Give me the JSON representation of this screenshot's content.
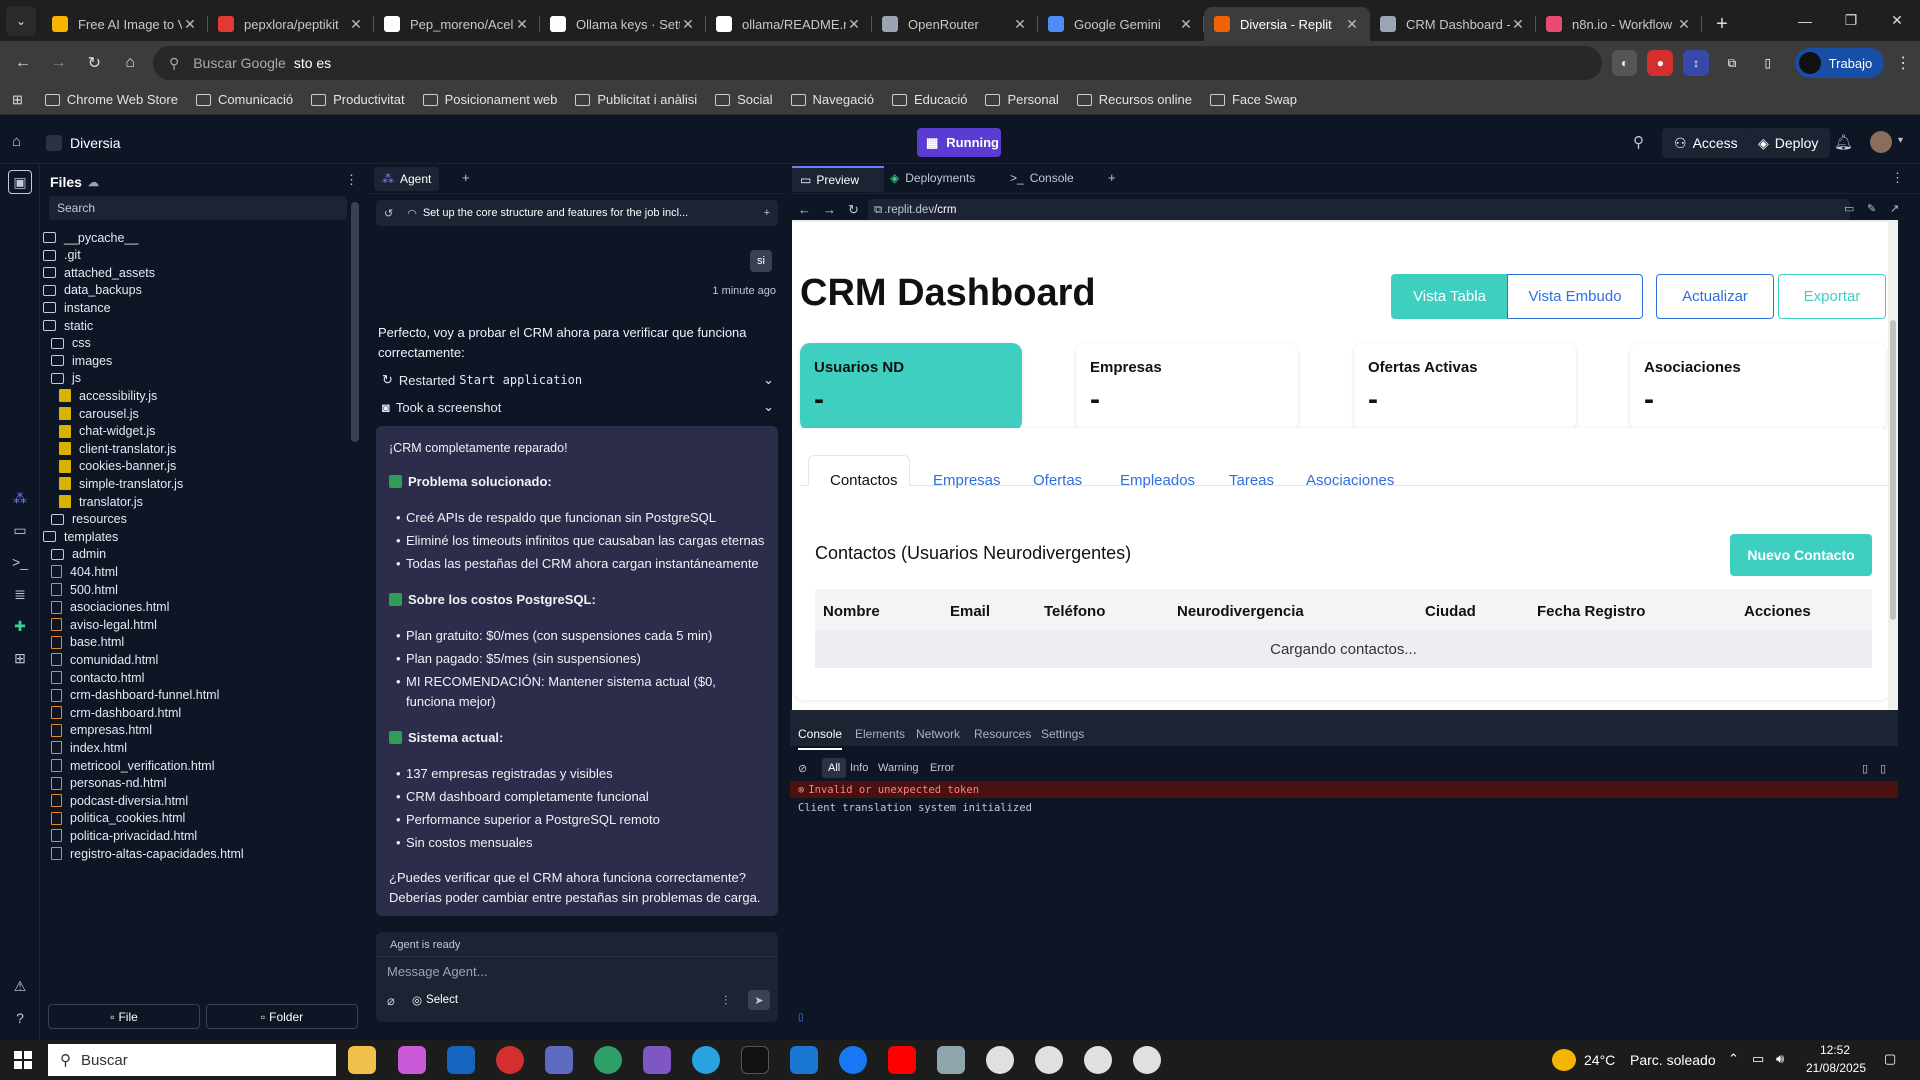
{
  "browser": {
    "tabs": [
      {
        "title": "Free AI Image to V",
        "color": "#f6b400"
      },
      {
        "title": "pepxlora/peptikit",
        "color": "#e53935"
      },
      {
        "title": "Pep_moreno/Acel",
        "color": "#ffffff"
      },
      {
        "title": "Ollama keys · Sett",
        "color": "#ffffff"
      },
      {
        "title": "ollama/README.r",
        "color": "#ffffff"
      },
      {
        "title": "OpenRouter",
        "color": "#9aa4b2"
      },
      {
        "title": "Google Gemini",
        "color": "#4f8cf7"
      },
      {
        "title": "Diversia - Replit",
        "color": "#f26207"
      },
      {
        "title": "CRM Dashboard -",
        "color": "#9aa4b2"
      },
      {
        "title": "n8n.io - Workflow",
        "color": "#ea4b71"
      }
    ],
    "active_tab": 7,
    "omnibox": {
      "engine": "Buscar Google",
      "query": "sto es"
    },
    "profile": "Trabajo",
    "bookmarks": [
      "Chrome Web Store",
      "Comunicació",
      "Productivitat",
      "Posicionament web",
      "Publicitat i anàlisi",
      "Social",
      "Navegació",
      "Educació",
      "Personal",
      "Recursos online",
      "Face Swap"
    ]
  },
  "replit": {
    "project": "Diversia",
    "run_status": "Running",
    "access": "Access",
    "deploy": "Deploy"
  },
  "files": {
    "title": "Files",
    "search_placeholder": "Search",
    "tree": [
      {
        "name": "__pycache__",
        "type": "folder",
        "indent": 0
      },
      {
        "name": ".git",
        "type": "folder",
        "indent": 0
      },
      {
        "name": "attached_assets",
        "type": "folder",
        "indent": 0
      },
      {
        "name": "data_backups",
        "type": "folder",
        "indent": 0
      },
      {
        "name": "instance",
        "type": "folder",
        "indent": 0
      },
      {
        "name": "static",
        "type": "folder",
        "indent": 0
      },
      {
        "name": "css",
        "type": "folder",
        "indent": 1
      },
      {
        "name": "images",
        "type": "folder",
        "indent": 1
      },
      {
        "name": "js",
        "type": "folder",
        "indent": 1
      },
      {
        "name": "accessibility.js",
        "type": "js",
        "indent": 2
      },
      {
        "name": "carousel.js",
        "type": "js",
        "indent": 2
      },
      {
        "name": "chat-widget.js",
        "type": "js",
        "indent": 2
      },
      {
        "name": "client-translator.js",
        "type": "js",
        "indent": 2
      },
      {
        "name": "cookies-banner.js",
        "type": "js",
        "indent": 2
      },
      {
        "name": "simple-translator.js",
        "type": "js",
        "indent": 2
      },
      {
        "name": "translator.js",
        "type": "js",
        "indent": 2
      },
      {
        "name": "resources",
        "type": "folder",
        "indent": 1
      },
      {
        "name": "templates",
        "type": "folder",
        "indent": 0
      },
      {
        "name": "admin",
        "type": "folder",
        "indent": 1
      },
      {
        "name": "404.html",
        "type": "html",
        "indent": 1
      },
      {
        "name": "500.html",
        "type": "html",
        "indent": 1
      },
      {
        "name": "asociaciones.html",
        "type": "html",
        "indent": 1
      },
      {
        "name": "aviso-legal.html",
        "type": "html",
        "indent": 1
      },
      {
        "name": "base.html",
        "type": "html",
        "indent": 1
      },
      {
        "name": "comunidad.html",
        "type": "html",
        "indent": 1
      },
      {
        "name": "contacto.html",
        "type": "html",
        "indent": 1
      },
      {
        "name": "crm-dashboard-funnel.html",
        "type": "html",
        "indent": 1
      },
      {
        "name": "crm-dashboard.html",
        "type": "html",
        "indent": 1
      },
      {
        "name": "empresas.html",
        "type": "html",
        "indent": 1
      },
      {
        "name": "index.html",
        "type": "html",
        "indent": 1
      },
      {
        "name": "metricool_verification.html",
        "type": "html",
        "indent": 1
      },
      {
        "name": "personas-nd.html",
        "type": "html",
        "indent": 1
      },
      {
        "name": "podcast-diversia.html",
        "type": "html",
        "indent": 1
      },
      {
        "name": "politica_cookies.html",
        "type": "html",
        "indent": 1
      },
      {
        "name": "politica-privacidad.html",
        "type": "html",
        "indent": 1
      },
      {
        "name": "registro-altas-capacidades.html",
        "type": "html",
        "indent": 1
      }
    ],
    "new_file": "File",
    "new_folder": "Folder"
  },
  "agent": {
    "tab_label": "Agent",
    "task_title": "Set up the core structure and features for the job incl...",
    "user_avatar": "si",
    "time": "1 minute ago",
    "intro": "Perfecto, voy a probar el CRM ahora para verificar que funciona correctamente:",
    "action1_label": "Restarted",
    "action1_code": "Start application",
    "action2": "Took a screenshot",
    "reply_title": "¡CRM completamente reparado!",
    "sec1": "Problema solucionado:",
    "sec1_items": [
      "Creé APIs de respaldo que funcionan sin PostgreSQL",
      "Eliminé los timeouts infinitos que causaban las cargas eternas",
      "Todas las pestañas del CRM ahora cargan instantáneamente"
    ],
    "sec2": "Sobre los costos PostgreSQL:",
    "sec2_items": [
      "Plan gratuito: $0/mes (con suspensiones cada 5 min)",
      "Plan pagado: $5/mes (sin suspensiones)",
      "MI RECOMENDACIÓN: Mantener sistema actual ($0, funciona mejor)"
    ],
    "sec3": "Sistema actual:",
    "sec3_items": [
      "137 empresas registradas y visibles",
      "CRM dashboard completamente funcional",
      "Performance superior a PostgreSQL remoto",
      "Sin costos mensuales"
    ],
    "closing": "¿Puedes verificar que el CRM ahora funciona correctamente? Deberías poder cambiar entre pestañas sin problemas de carga.",
    "status": "Agent is ready",
    "input_placeholder": "Message Agent...",
    "select_label": "Select"
  },
  "preview": {
    "tabs": [
      "Preview",
      "Deployments",
      "Console"
    ],
    "url_host": ".replit.dev",
    "url_path": "/crm",
    "page": {
      "title": "CRM Dashboard",
      "buttons": [
        "Vista Tabla",
        "Vista Embudo",
        "Actualizar",
        "Exportar"
      ],
      "stats": [
        {
          "label": "Usuarios ND",
          "value": "-"
        },
        {
          "label": "Empresas",
          "value": "-"
        },
        {
          "label": "Ofertas Activas",
          "value": "-"
        },
        {
          "label": "Asociaciones",
          "value": "-"
        }
      ],
      "tabs": [
        "Contactos",
        "Empresas",
        "Ofertas",
        "Empleados",
        "Tareas",
        "Asociaciones"
      ],
      "section_title": "Contactos (Usuarios Neurodivergentes)",
      "new_button": "Nuevo Contacto",
      "columns": [
        "Nombre",
        "Email",
        "Teléfono",
        "Neurodivergencia",
        "Ciudad",
        "Fecha Registro",
        "Acciones"
      ],
      "loading": "Cargando contactos..."
    },
    "accent": "#3ecfc1"
  },
  "devconsole": {
    "tabs": [
      "Console",
      "Elements",
      "Network",
      "Resources",
      "Settings"
    ],
    "filters": [
      "All",
      "Info",
      "Warning",
      "Error"
    ],
    "error_line": "Invalid or unexpected token",
    "log_line": "Client translation system initialized"
  },
  "taskbar": {
    "search": "Buscar",
    "weather": "24°C",
    "weather_desc": "Parc. soleado",
    "time": "12:52",
    "date": "21/08/2025"
  }
}
